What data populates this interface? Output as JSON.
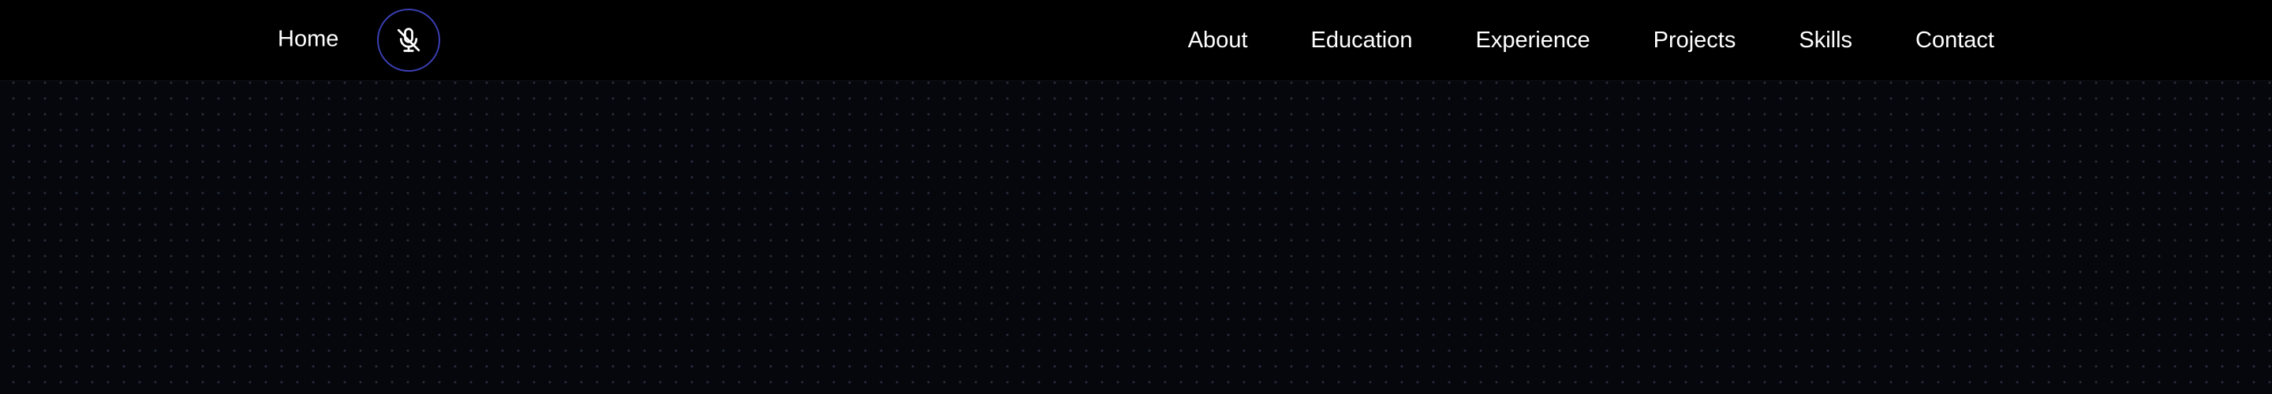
{
  "nav": {
    "home_label": "Home",
    "mic_icon": "mic-off-icon",
    "links": [
      {
        "label": "About"
      },
      {
        "label": "Education"
      },
      {
        "label": "Experience"
      },
      {
        "label": "Projects"
      },
      {
        "label": "Skills"
      },
      {
        "label": "Contact"
      }
    ]
  },
  "colors": {
    "nav_background": "#000000",
    "page_background": "#05070d",
    "text": "#ffffff",
    "mic_ring": "#3b3fb4",
    "dot_grid": "#262c3a"
  }
}
